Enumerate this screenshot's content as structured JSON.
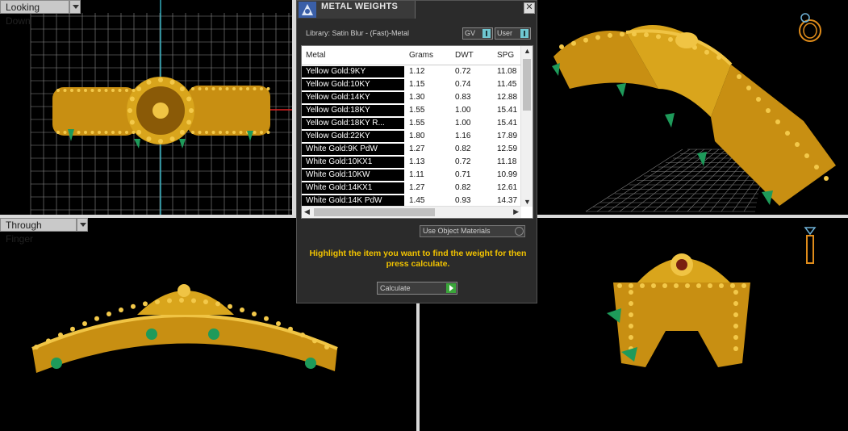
{
  "viewports": {
    "top_left": {
      "label": "Looking Down"
    },
    "bottom_left": {
      "label": "Through Finger"
    }
  },
  "dialog": {
    "title": "METAL WEIGHTS",
    "close_icon": "close-icon",
    "library": "Library: Satin Blur - (Fast)-Metal",
    "gv_label": "GV",
    "user_label": "User",
    "columns": [
      "Metal",
      "Grams",
      "DWT",
      "SPG"
    ],
    "rows": [
      [
        "Yellow Gold:9KY",
        "1.12",
        "0.72",
        "11.08"
      ],
      [
        "Yellow Gold:10KY",
        "1.15",
        "0.74",
        "11.45"
      ],
      [
        "Yellow Gold:14KY",
        "1.30",
        "0.83",
        "12.88"
      ],
      [
        "Yellow Gold:18KY",
        "1.55",
        "1.00",
        "15.41"
      ],
      [
        "Yellow Gold:18KY R...",
        "1.55",
        "1.00",
        "15.41"
      ],
      [
        "Yellow Gold:22KY",
        "1.80",
        "1.16",
        "17.89"
      ],
      [
        "White Gold:9K PdW",
        "1.27",
        "0.82",
        "12.59"
      ],
      [
        "White Gold:10KX1",
        "1.13",
        "0.72",
        "11.18"
      ],
      [
        "White Gold:10KW",
        "1.11",
        "0.71",
        "10.99"
      ],
      [
        "White Gold:14KX1",
        "1.27",
        "0.82",
        "12.61"
      ],
      [
        "White Gold:14K PdW",
        "1.45",
        "0.93",
        "14.37"
      ]
    ],
    "use_object_materials": "Use Object Materials",
    "hint": "Highlight the item you want to find the weight for then press calculate.",
    "calculate": "Calculate"
  },
  "colors": {
    "gold": "#d9a51c",
    "emerald": "#1e9a5a",
    "hint": "#f2c300",
    "grid": "#9a9a9a"
  }
}
